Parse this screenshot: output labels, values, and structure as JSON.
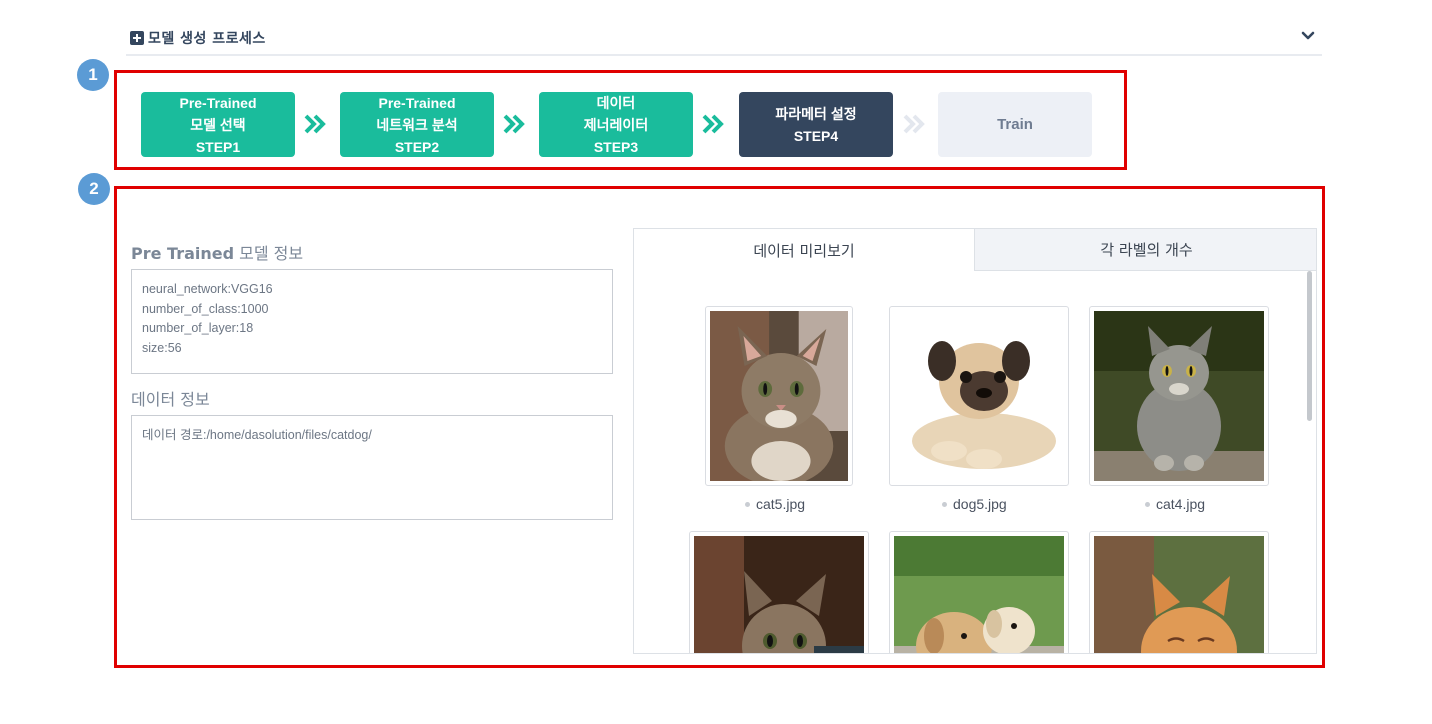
{
  "header": {
    "title": "모델 생성 프로세스"
  },
  "badges": {
    "one": "1",
    "two": "2"
  },
  "steps": [
    {
      "line1": "Pre-Trained",
      "line2": "모델 선택",
      "line3": "STEP1"
    },
    {
      "line1": "Pre-Trained",
      "line2": "네트워크 분석",
      "line3": "STEP2"
    },
    {
      "line1": "데이터",
      "line2": "제너레이터",
      "line3": "STEP3"
    },
    {
      "line1": "파라메터 설정",
      "line2": "STEP4"
    },
    {
      "line1": "Train"
    }
  ],
  "pretrained": {
    "title_bold": "Pre Trained",
    "title_rest": " 모델 정보",
    "lines": [
      "neural_network:VGG16",
      "number_of_class:1000",
      "number_of_layer:18",
      "size:56"
    ]
  },
  "data_info": {
    "title": "데이터 정보",
    "path_line": "데이터 경로:/home/dasolution/files/catdog/"
  },
  "preview": {
    "tab_active": "데이터 미리보기",
    "tab_inactive": "각 라벨의 개수",
    "images": [
      {
        "file": "cat5.jpg"
      },
      {
        "file": "dog5.jpg"
      },
      {
        "file": "cat4.jpg"
      },
      {
        "file": ""
      },
      {
        "file": ""
      },
      {
        "file": ""
      }
    ]
  }
}
